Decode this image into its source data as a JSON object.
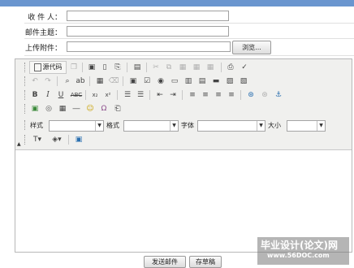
{
  "form": {
    "recipient_label": "收 件 人：",
    "recipient_value": "",
    "subject_label": "邮件主题：",
    "subject_value": "",
    "attachment_label": "上传附件：",
    "attachment_value": "",
    "browse_label": "浏览..."
  },
  "toolbar": {
    "source_label": "源代码",
    "row1_icons": [
      "copy-page-icon",
      "save-icon",
      "new-page-icon",
      "preview-icon",
      "templates-icon",
      "cut-icon",
      "copy-icon",
      "paste-icon",
      "paste-text-icon",
      "paste-word-icon",
      "print-icon",
      "spellcheck-icon"
    ],
    "row2_icons": [
      "undo-icon",
      "redo-icon",
      "find-icon",
      "replace-icon",
      "select-all-icon",
      "remove-format-icon",
      "form-icon",
      "checkbox-icon",
      "radio-icon",
      "textfield-icon",
      "textarea-icon",
      "select-field-icon",
      "button-icon",
      "image-button-icon",
      "hidden-field-icon"
    ],
    "row3_icons": [
      "bold-icon",
      "italic-icon",
      "underline-icon",
      "strike-icon",
      "subscript-icon",
      "superscript-icon",
      "numbered-list-icon",
      "bulleted-list-icon",
      "outdent-icon",
      "indent-icon",
      "align-left-icon",
      "align-center-icon",
      "align-right-icon",
      "justify-icon",
      "link-icon",
      "unlink-icon",
      "anchor-icon"
    ],
    "row4_icons": [
      "image-icon",
      "flash-icon",
      "table-icon",
      "horizontal-rule-icon",
      "smiley-icon",
      "special-char-icon",
      "page-break-icon"
    ],
    "style_label": "样式",
    "format_label": "格式",
    "font_label": "字体",
    "size_label": "大小",
    "style_value": "",
    "format_value": "",
    "font_value": "",
    "size_value": ""
  },
  "actions": {
    "send_label": "发送邮件",
    "draft_label": "存草稿"
  },
  "watermark": {
    "title": "毕业设计(论文)网",
    "url": "www.56DOC.com"
  }
}
